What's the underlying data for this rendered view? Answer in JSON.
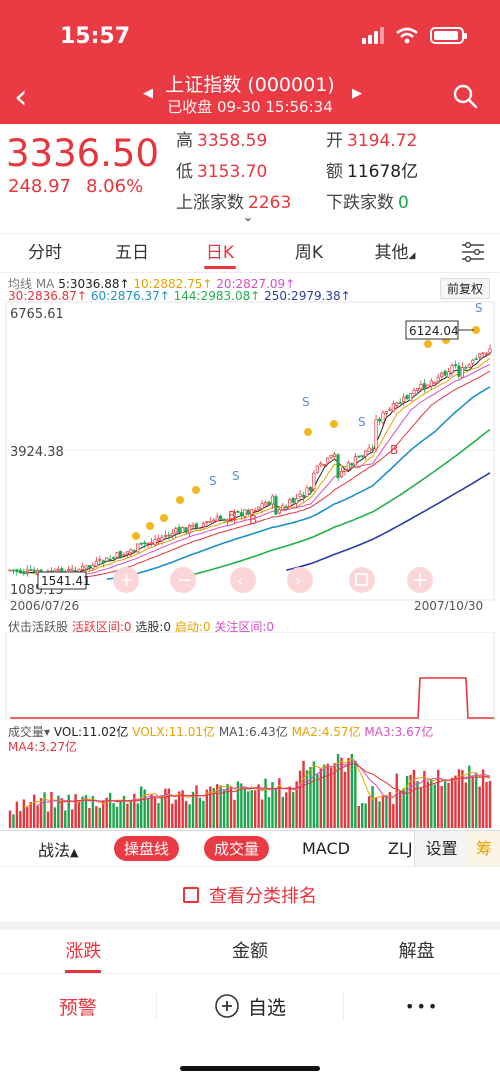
{
  "status": {
    "time": "15:57"
  },
  "header": {
    "title": "上证指数 (000001)",
    "subtitle": "已收盘 09-30 15:56:34"
  },
  "quote": {
    "price": "3336.50",
    "change": "248.97",
    "pct": "8.06%",
    "high_label": "高",
    "high": "3358.59",
    "open_label": "开",
    "open": "3194.72",
    "low_label": "低",
    "low": "3153.70",
    "amount_label": "额",
    "amount": "11678亿",
    "up_label": "上涨家数",
    "up": "2263",
    "down_label": "下跌家数",
    "down": "0"
  },
  "tabs": [
    "分时",
    "五日",
    "日K",
    "周K",
    "其他"
  ],
  "active_tab": 2,
  "ma": {
    "line1": [
      "均线 MA",
      "5:3036.88↑",
      "10:2882.75↑",
      "20:2827.09↑"
    ],
    "line2": [
      "30:2836.87↑",
      "60:2876.37↑",
      "144:2983.08↑",
      "250:2979.38↑"
    ],
    "colors": [
      "#777777",
      "#222222",
      "#e8a200",
      "#d54fc4",
      "#e8343c",
      "#1e90c8",
      "#23b04a",
      "#2b3ba8"
    ]
  },
  "restore_label": "前复权",
  "chart_data": {
    "type": "candlestick",
    "y_high_label": "6765.61",
    "y_mid_label": "3924.38",
    "y_low_label": "1085.15",
    "x_start": "2006/07/26",
    "x_end": "2007/10/30",
    "peak_tag": "6124.04",
    "low_tag": "1541.41",
    "ylim": [
      1085.15,
      6765.61
    ]
  },
  "sub1": {
    "name": "伏击活跃股",
    "items": [
      "活跃区间:0",
      "选股:0",
      "启动:0",
      "关注区间:0"
    ]
  },
  "vol": {
    "name": "成交量",
    "line1": [
      "VOL:11.02亿",
      "VOLX:11.01亿",
      "MA1:6.43亿",
      "MA2:4.57亿",
      "MA3:3.67亿"
    ],
    "line2": [
      "MA4:3.27亿"
    ]
  },
  "ind_bar": {
    "zhanfa": "战法",
    "pill1": "操盘线",
    "pill2": "成交量",
    "macd": "MACD",
    "zlj": "ZLJ",
    "settings": "设置",
    "chou": "筹"
  },
  "rank_link": "查看分类排名",
  "bottom_tabs": [
    "涨跌",
    "金额",
    "解盘"
  ],
  "actions": {
    "alert": "预警",
    "watch": "自选",
    "more": "•••"
  },
  "colors": {
    "red": "#e8343c",
    "green": "#1aa64b",
    "header": "#ea3b45"
  }
}
